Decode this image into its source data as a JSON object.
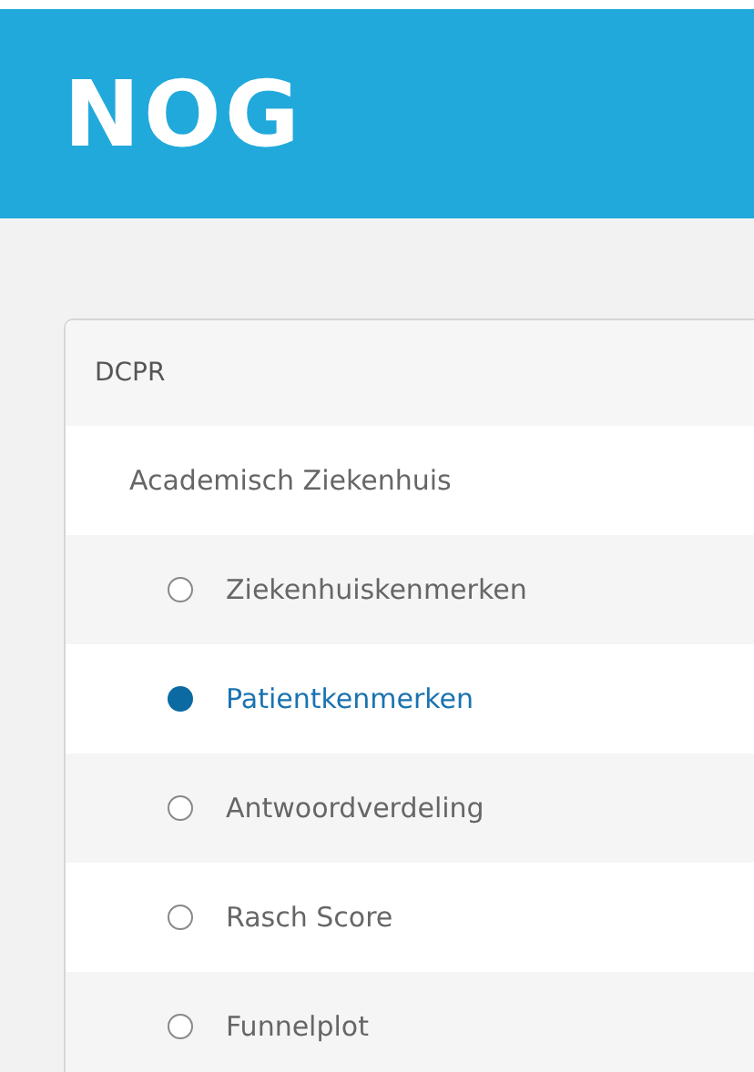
{
  "header": {
    "logo": "NOG"
  },
  "panel": {
    "title": "DCPR",
    "group": "Academisch Ziekenhuis",
    "items": [
      {
        "label": "Ziekenhuiskenmerken",
        "selected": false
      },
      {
        "label": "Patientkenmerken",
        "selected": true
      },
      {
        "label": "Antwoordverdeling",
        "selected": false
      },
      {
        "label": "Rasch Score",
        "selected": false
      },
      {
        "label": "Funnelplot",
        "selected": false
      }
    ]
  }
}
